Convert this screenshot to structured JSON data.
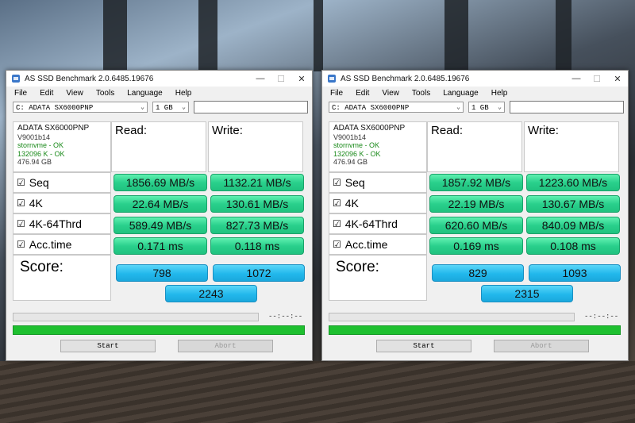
{
  "windows": [
    {
      "title": "AS SSD Benchmark 2.0.6485.19676",
      "menu": [
        "File",
        "Edit",
        "View",
        "Tools",
        "Language",
        "Help"
      ],
      "drive": "C: ADATA SX6000PNP",
      "size": "1 GB",
      "info": {
        "name": "ADATA SX6000PNP",
        "firmware": "V9001b14",
        "driver": "stornvme - OK",
        "alignment": "132096 K - OK",
        "capacity": "476.94 GB"
      },
      "headers": {
        "read": "Read:",
        "write": "Write:"
      },
      "rows": [
        {
          "label": "Seq",
          "read": "1856.69 MB/s",
          "write": "1132.21 MB/s"
        },
        {
          "label": "4K",
          "read": "22.64 MB/s",
          "write": "130.61 MB/s"
        },
        {
          "label": "4K-64Thrd",
          "read": "589.49 MB/s",
          "write": "827.73 MB/s"
        },
        {
          "label": "Acc.time",
          "read": "0.171 ms",
          "write": "0.118 ms"
        }
      ],
      "score": {
        "label": "Score:",
        "read": "798",
        "write": "1072",
        "total": "2243"
      },
      "time": "--:--:--",
      "buttons": {
        "start": "Start",
        "abort": "Abort"
      }
    },
    {
      "title": "AS SSD Benchmark 2.0.6485.19676",
      "menu": [
        "File",
        "Edit",
        "View",
        "Tools",
        "Language",
        "Help"
      ],
      "drive": "C: ADATA SX6000PNP",
      "size": "1 GB",
      "info": {
        "name": "ADATA SX6000PNP",
        "firmware": "V9001b14",
        "driver": "stornvme - OK",
        "alignment": "132096 K - OK",
        "capacity": "476.94 GB"
      },
      "headers": {
        "read": "Read:",
        "write": "Write:"
      },
      "rows": [
        {
          "label": "Seq",
          "read": "1857.92 MB/s",
          "write": "1223.60 MB/s"
        },
        {
          "label": "4K",
          "read": "22.19 MB/s",
          "write": "130.67 MB/s"
        },
        {
          "label": "4K-64Thrd",
          "read": "620.60 MB/s",
          "write": "840.09 MB/s"
        },
        {
          "label": "Acc.time",
          "read": "0.169 ms",
          "write": "0.108 ms"
        }
      ],
      "score": {
        "label": "Score:",
        "read": "829",
        "write": "1093",
        "total": "2315"
      },
      "time": "--:--:--",
      "buttons": {
        "start": "Start",
        "abort": "Abort"
      }
    }
  ],
  "checkmark": "☑"
}
